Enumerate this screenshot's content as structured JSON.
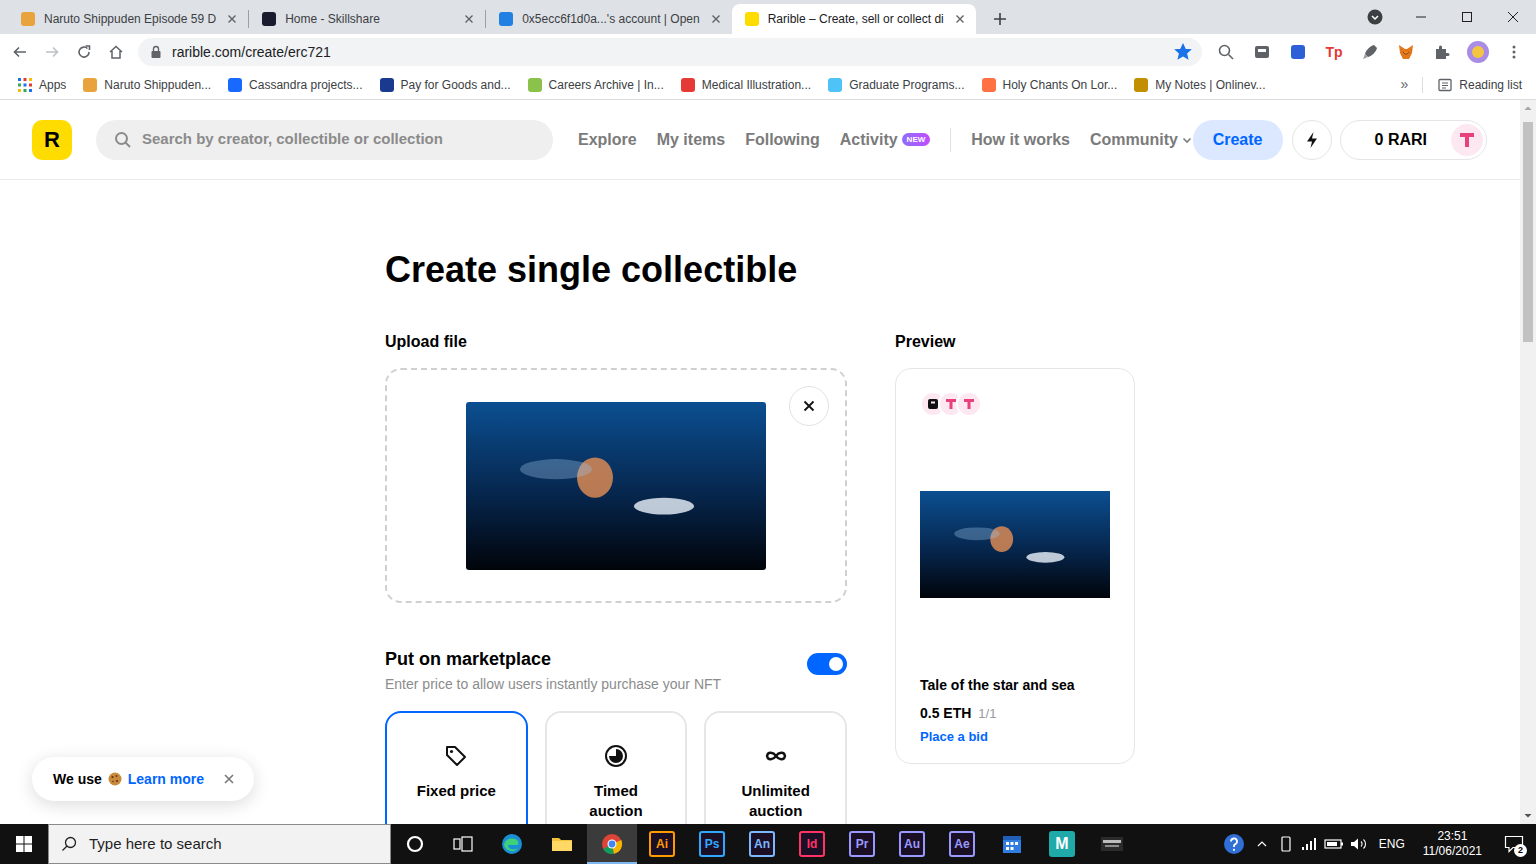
{
  "browser": {
    "tabs": [
      {
        "label": "Naruto Shippuden Episode 59 D",
        "selected": false
      },
      {
        "label": "Home - Skillshare",
        "selected": false
      },
      {
        "label": "0x5ecc6f1d0a...'s account | Open",
        "selected": false
      },
      {
        "label": "Rarible – Create, sell or collect di",
        "selected": true
      }
    ],
    "url": "rarible.com/create/erc721",
    "bookmarked": true,
    "extension_label": "Tp",
    "bookmarks": [
      "Apps",
      "Naruto Shippuden...",
      "Cassandra projects...",
      "Pay for Goods and...",
      "Careers Archive | In...",
      "Medical Illustration...",
      "Graduate Programs...",
      "Holy Chants On Lor...",
      "My Notes | Onlinev..."
    ],
    "bookmarks_more": "»",
    "reading_list": "Reading list"
  },
  "header": {
    "logo": "R",
    "search_placeholder": "Search by creator, collectible or collection",
    "nav": [
      "Explore",
      "My items",
      "Following",
      "Activity"
    ],
    "activity_badge": "NEW",
    "nav_secondary": [
      "How it works"
    ],
    "community": "Community",
    "create": "Create",
    "balance": "0 RARI"
  },
  "create": {
    "title": "Create single collectible",
    "upload_label": "Upload file",
    "marketplace": {
      "label": "Put on marketplace",
      "hint": "Enter price to allow users instantly purchase your NFT",
      "on": true
    },
    "sale_types": [
      {
        "label": "Fixed price",
        "kind": "fixed",
        "selected": true
      },
      {
        "label": "Timed auction",
        "kind": "timed",
        "selected": false
      },
      {
        "label": "Unlimited auction",
        "kind": "unlimited",
        "selected": false
      }
    ]
  },
  "preview": {
    "label": "Preview",
    "title": "Tale of the star and sea",
    "price": "0.5 ETH",
    "edition": "1/1",
    "action": "Place a bid"
  },
  "cookie": {
    "text": "We use",
    "link": "Learn more"
  },
  "taskbar": {
    "search": "Type here to search",
    "apps": [
      {
        "kind": "edge",
        "selected": false
      },
      {
        "kind": "explorer",
        "selected": false
      },
      {
        "kind": "chrome",
        "selected": true
      },
      {
        "kind": "adobe",
        "label": "Ai",
        "color": "#ff9a00",
        "selected": false
      },
      {
        "kind": "adobe",
        "label": "Ps",
        "color": "#31a8ff",
        "selected": false
      },
      {
        "kind": "adobe",
        "label": "An",
        "color": "#7db8ff",
        "selected": false
      },
      {
        "kind": "adobe",
        "label": "Id",
        "color": "#ff3366",
        "selected": false
      },
      {
        "kind": "adobe",
        "label": "Pr",
        "color": "#9999ff",
        "selected": false
      },
      {
        "kind": "adobe",
        "label": "Au",
        "color": "#9999ff",
        "selected": false
      },
      {
        "kind": "adobe",
        "label": "Ae",
        "color": "#9999ff",
        "selected": false
      },
      {
        "kind": "calendar",
        "selected": false
      },
      {
        "kind": "maya",
        "label": "M",
        "color": "#1fa9a9",
        "selected": false
      },
      {
        "kind": "game",
        "selected": false
      }
    ],
    "language": "ENG",
    "time": "23:51",
    "date": "11/06/2021",
    "notifications": "2"
  }
}
